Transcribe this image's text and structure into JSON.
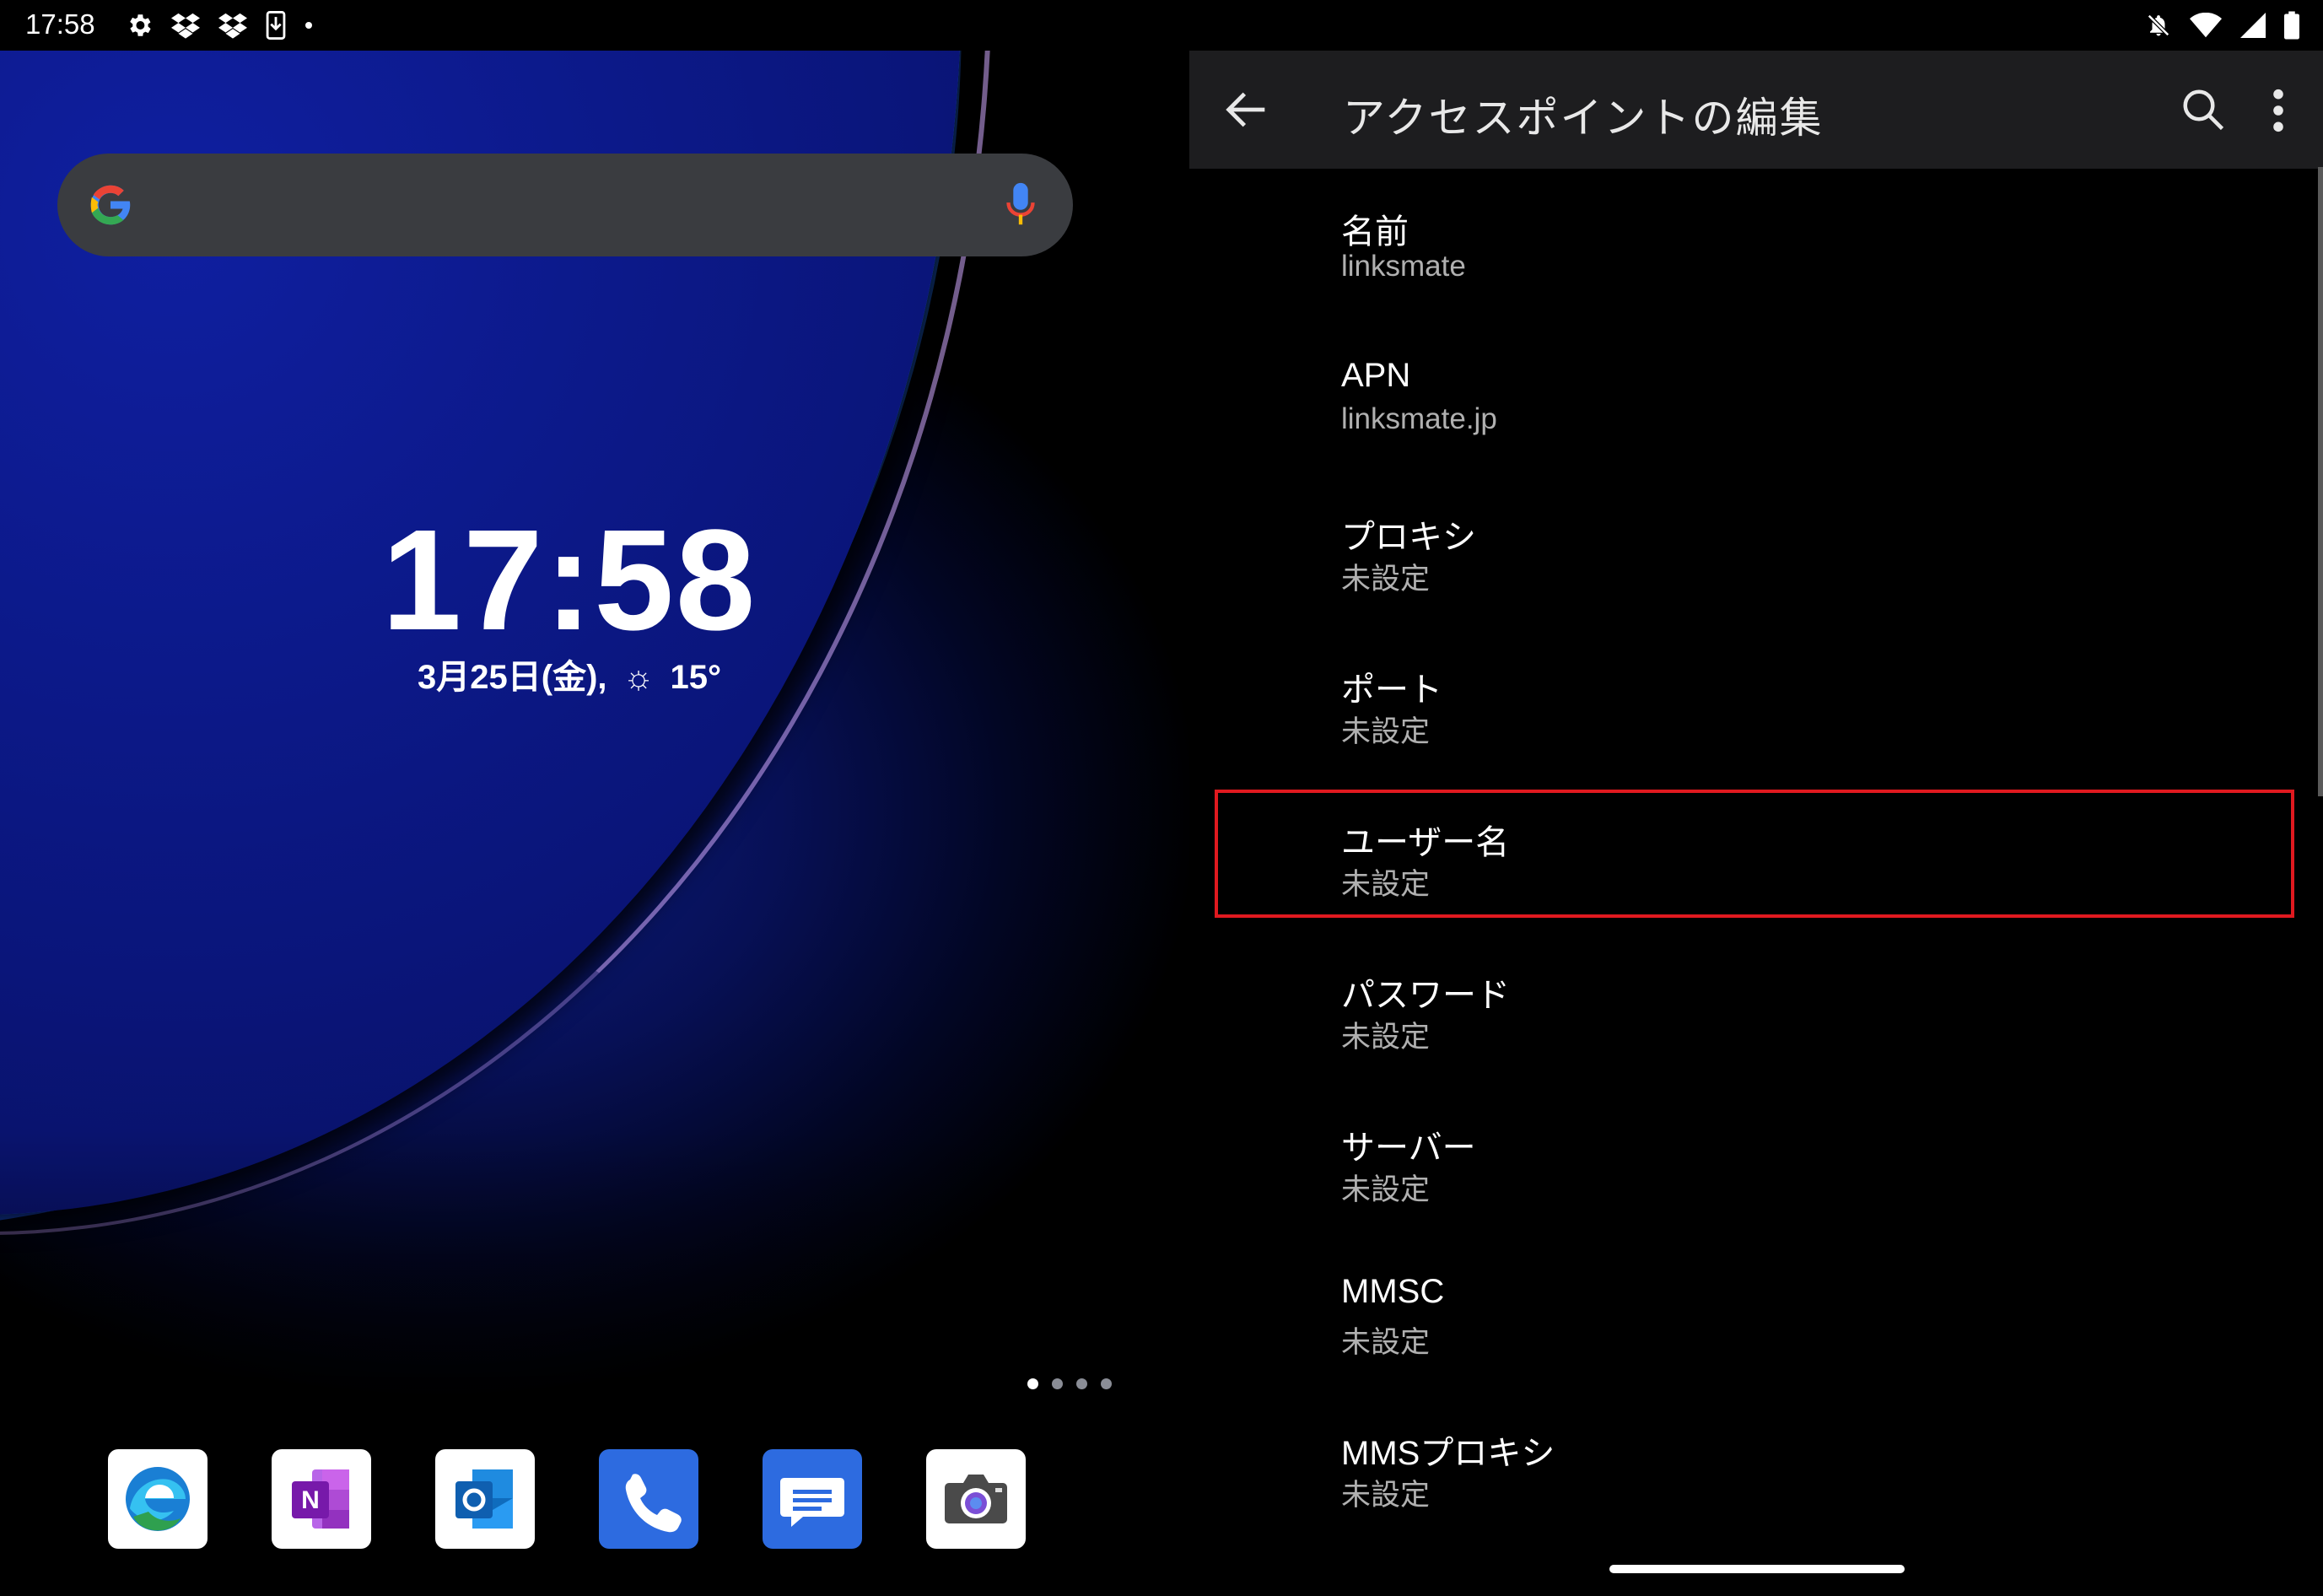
{
  "status_bar": {
    "time": "17:58",
    "left_icons": [
      "gear-icon",
      "dropbox-icon",
      "dropbox-icon",
      "download-icon",
      "dot-icon"
    ],
    "right_icons": [
      "notifications-off-icon",
      "wifi-icon",
      "cell-signal-icon",
      "battery-icon"
    ]
  },
  "home_screen": {
    "search_bar": {
      "logo": "google-logo",
      "mic": "mic-icon"
    },
    "clock": "17:58",
    "date": "3月25日(金),",
    "weather_icon": "sun-icon",
    "temperature": "15°",
    "page_count": 4,
    "active_page": 1,
    "dock": [
      {
        "name": "edge-app",
        "icon": "edge-icon"
      },
      {
        "name": "onenote-app",
        "icon": "onenote-icon"
      },
      {
        "name": "outlook-app",
        "icon": "outlook-icon"
      },
      {
        "name": "phone-app",
        "icon": "phone-icon"
      },
      {
        "name": "messages-app",
        "icon": "message-icon"
      },
      {
        "name": "camera-app",
        "icon": "camera-icon"
      }
    ]
  },
  "settings": {
    "title": "アクセスポイントの編集",
    "items": [
      {
        "title": "名前",
        "summary": "linksmate"
      },
      {
        "title": "APN",
        "summary": "linksmate.jp"
      },
      {
        "title": "プロキシ",
        "summary": "未設定"
      },
      {
        "title": "ポート",
        "summary": "未設定"
      },
      {
        "title": "ユーザー名",
        "summary": "未設定"
      },
      {
        "title": "パスワード",
        "summary": "未設定"
      },
      {
        "title": "サーバー",
        "summary": "未設定"
      },
      {
        "title": "MMSC",
        "summary": "未設定"
      },
      {
        "title": "MMSプロキシ",
        "summary": "未設定"
      }
    ],
    "highlighted_item": "ユーザー名",
    "colors": {
      "appbar": "#1d1d1f",
      "highlight": "#e0191f"
    }
  }
}
